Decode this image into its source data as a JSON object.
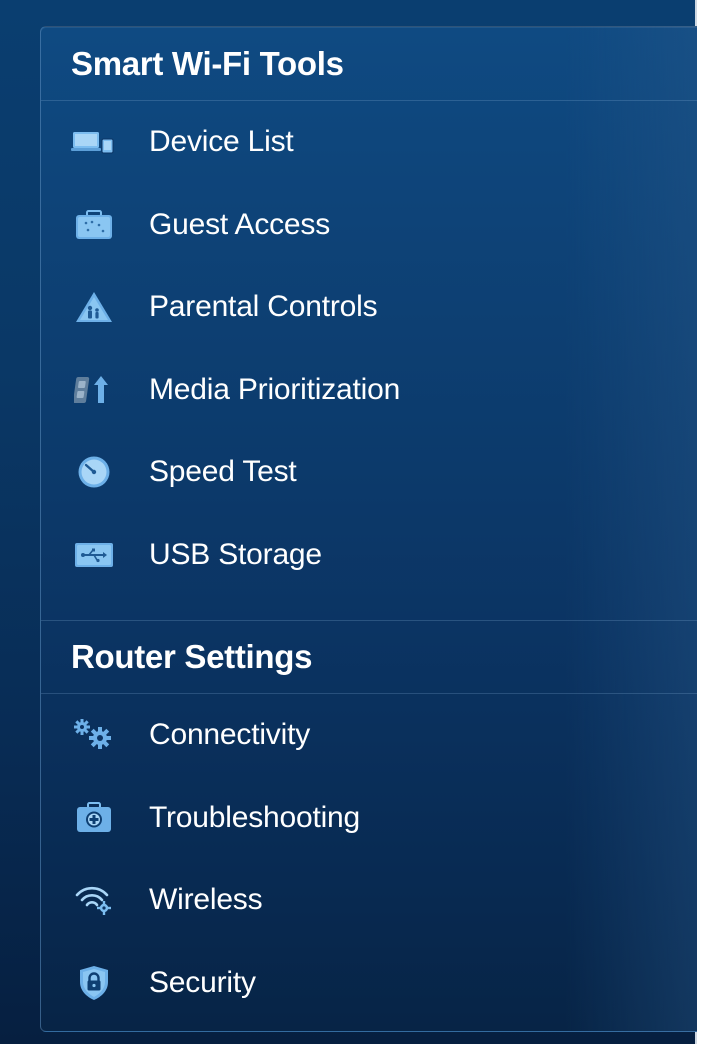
{
  "sections": [
    {
      "title": "Smart Wi-Fi Tools",
      "items": [
        {
          "label": "Device List",
          "icon": "device-list-icon"
        },
        {
          "label": "Guest Access",
          "icon": "guest-access-icon"
        },
        {
          "label": "Parental Controls",
          "icon": "parental-controls-icon"
        },
        {
          "label": "Media Prioritization",
          "icon": "media-prioritization-icon"
        },
        {
          "label": "Speed Test",
          "icon": "speed-test-icon"
        },
        {
          "label": "USB Storage",
          "icon": "usb-storage-icon"
        }
      ]
    },
    {
      "title": "Router Settings",
      "items": [
        {
          "label": "Connectivity",
          "icon": "connectivity-icon"
        },
        {
          "label": "Troubleshooting",
          "icon": "troubleshooting-icon"
        },
        {
          "label": "Wireless",
          "icon": "wireless-icon"
        },
        {
          "label": "Security",
          "icon": "security-icon"
        }
      ]
    }
  ],
  "colors": {
    "background": "#0a3866",
    "text": "#ffffff",
    "icon_accent": "#6fb3e8"
  }
}
